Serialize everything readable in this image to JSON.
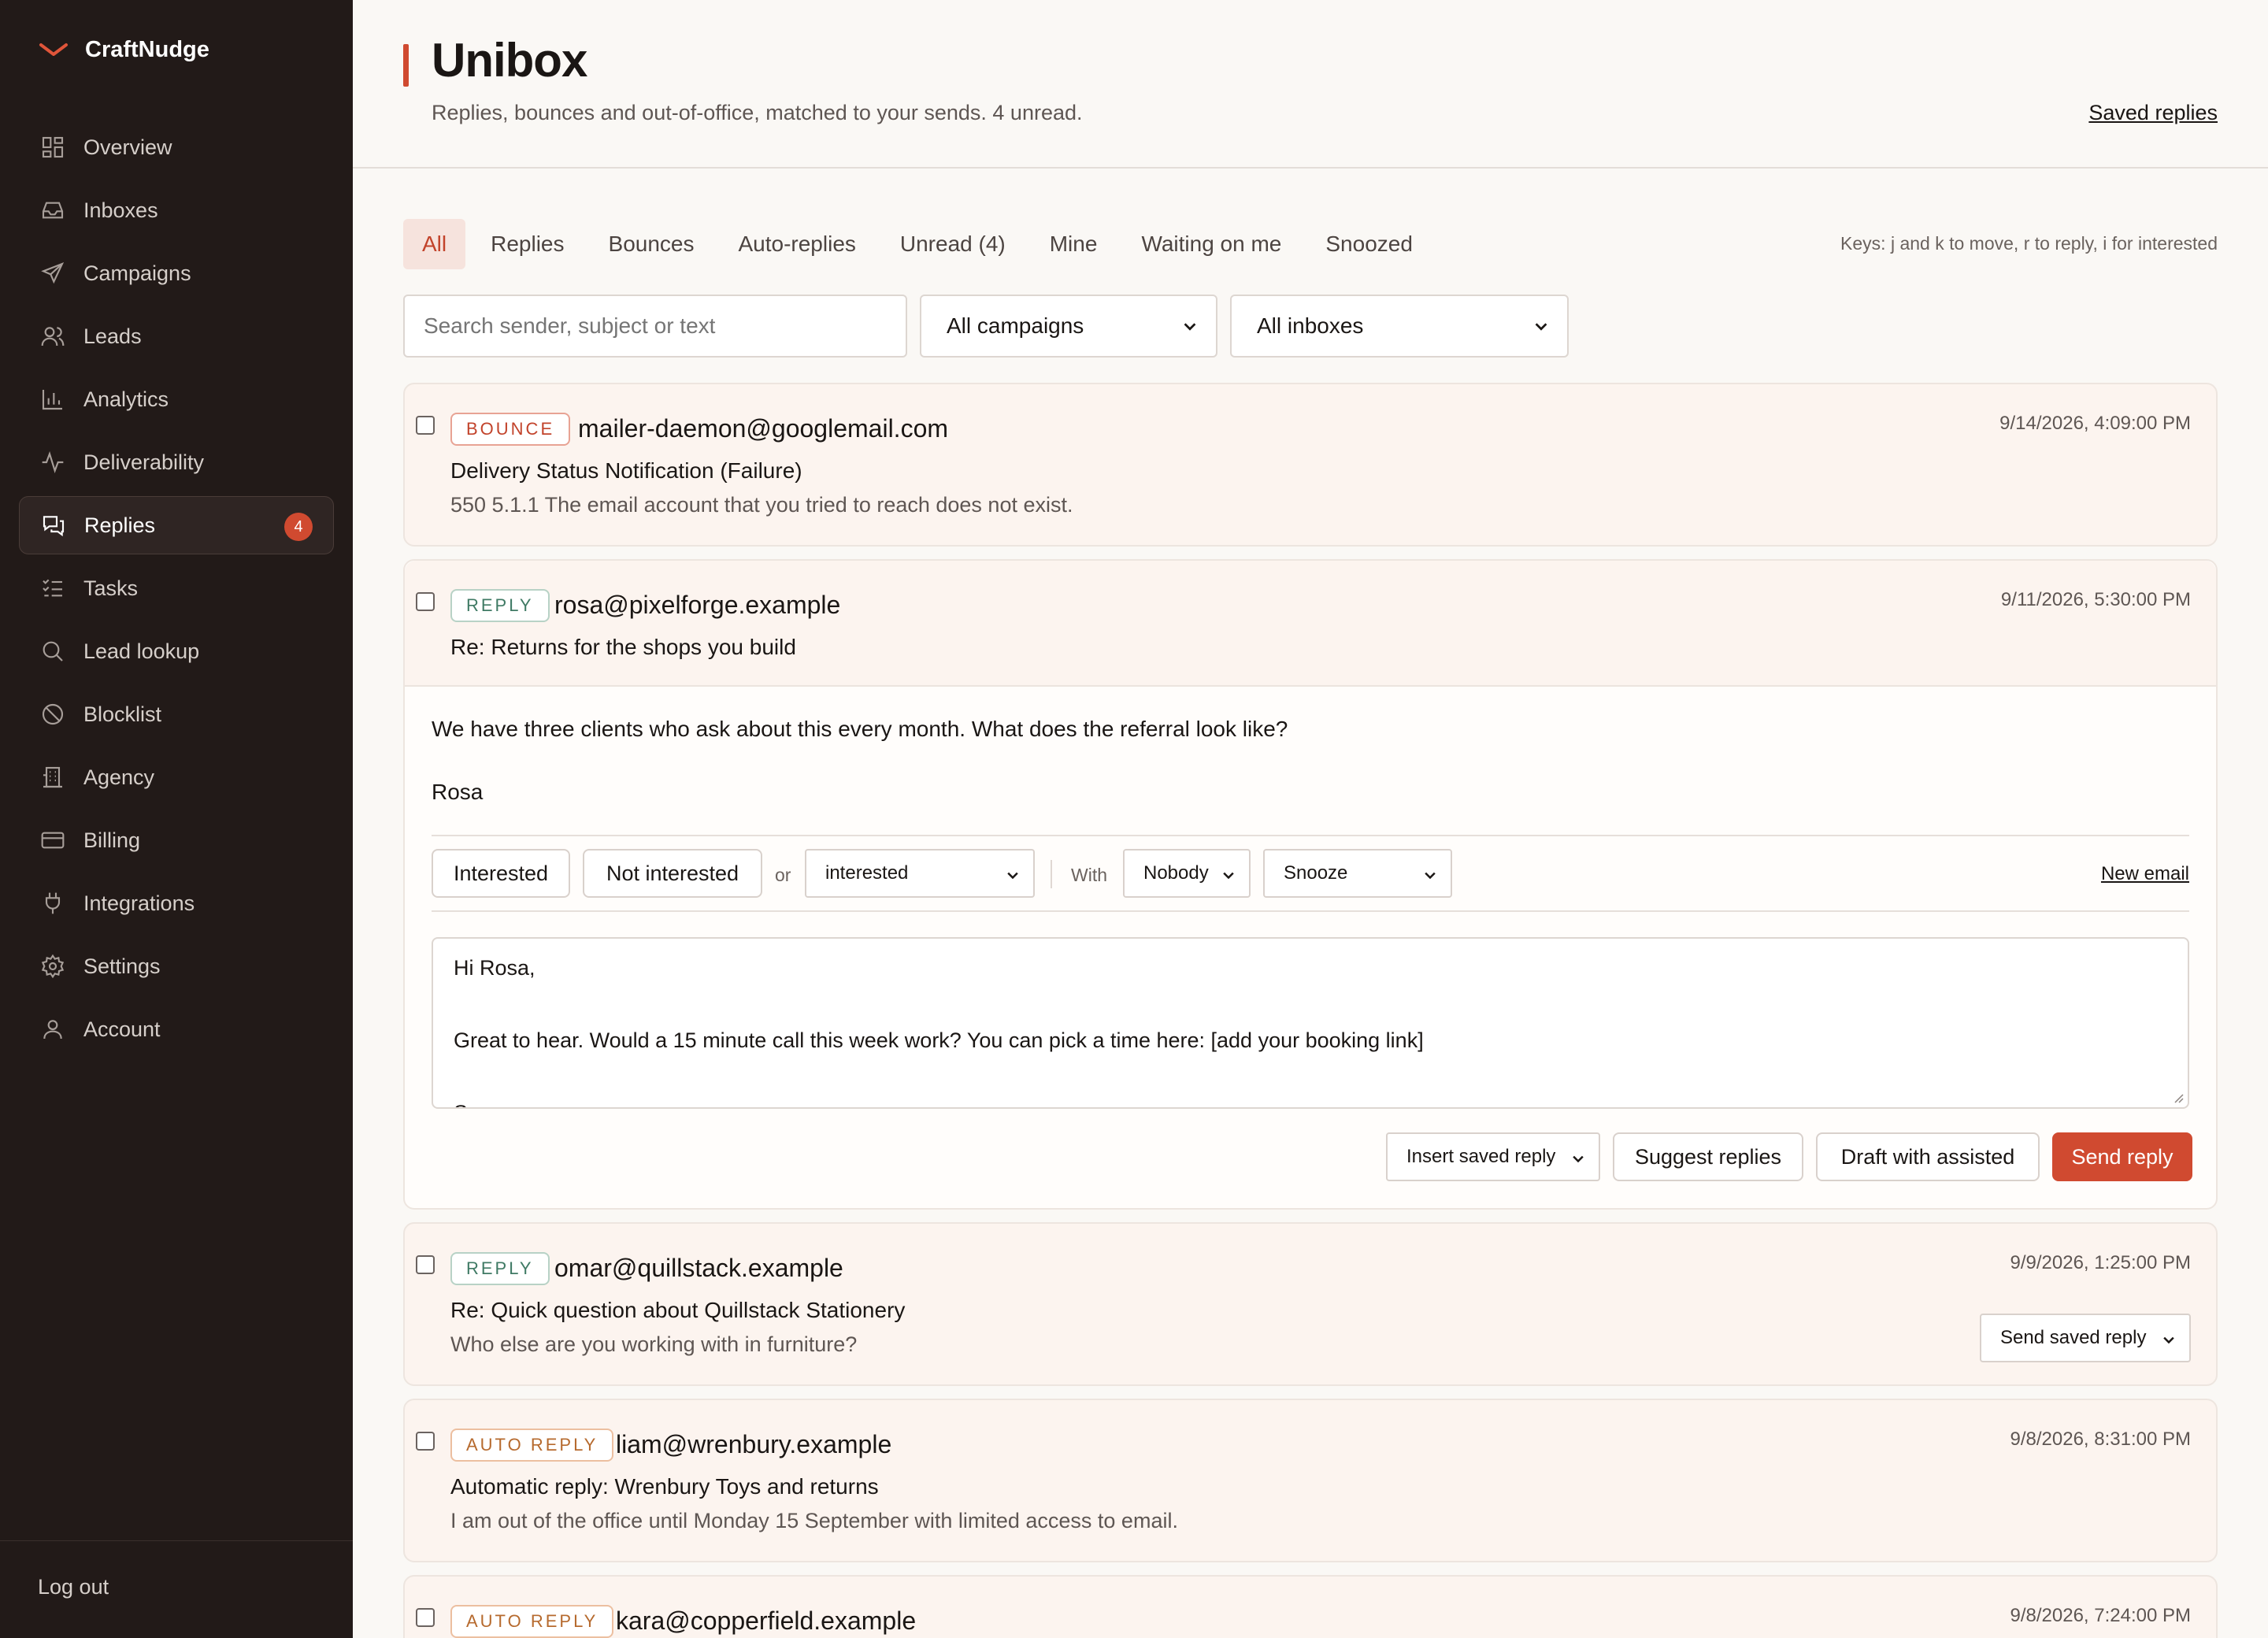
{
  "brand": {
    "name": "CraftNudge"
  },
  "nav": {
    "items": [
      {
        "label": "Overview",
        "icon": "grid-icon"
      },
      {
        "label": "Inboxes",
        "icon": "inbox-icon"
      },
      {
        "label": "Campaigns",
        "icon": "send-icon"
      },
      {
        "label": "Leads",
        "icon": "users-icon"
      },
      {
        "label": "Analytics",
        "icon": "bar-chart-icon"
      },
      {
        "label": "Deliverability",
        "icon": "pulse-icon"
      },
      {
        "label": "Replies",
        "icon": "chat-icon",
        "badge": "4",
        "active": true
      },
      {
        "label": "Tasks",
        "icon": "checklist-icon"
      },
      {
        "label": "Lead lookup",
        "icon": "search-icon"
      },
      {
        "label": "Blocklist",
        "icon": "ban-icon"
      },
      {
        "label": "Agency",
        "icon": "building-icon"
      },
      {
        "label": "Billing",
        "icon": "credit-card-icon"
      },
      {
        "label": "Integrations",
        "icon": "plug-icon"
      },
      {
        "label": "Settings",
        "icon": "gear-icon"
      },
      {
        "label": "Account",
        "icon": "user-icon"
      }
    ],
    "logout": "Log out"
  },
  "header": {
    "title": "Unibox",
    "subtitle": "Replies, bounces and out-of-office, matched to your sends. 4 unread.",
    "saved_replies": "Saved replies"
  },
  "tabs": [
    "All",
    "Replies",
    "Bounces",
    "Auto-replies",
    "Unread (4)",
    "Mine",
    "Waiting on me",
    "Snoozed"
  ],
  "keys_hint": "Keys: j and k to move, r to reply, i for interested",
  "filters": {
    "search_placeholder": "Search sender, subject or text",
    "campaign": "All campaigns",
    "inbox": "All inboxes"
  },
  "messages": [
    {
      "type": "BOUNCE",
      "sender": "mailer-daemon@googlemail.com",
      "time": "9/14/2026, 4:09:00 PM",
      "subject": "Delivery Status Notification (Failure)",
      "snippet": "550 5.1.1 The email account that you tried to reach does not exist."
    },
    {
      "type": "REPLY",
      "sender": "rosa@pixelforge.example",
      "time": "9/11/2026, 5:30:00 PM",
      "subject": "Re: Returns for the shops you build",
      "body": [
        "We have three clients who ask about this every month. What does the referral look like?",
        "Rosa"
      ]
    },
    {
      "type": "REPLY",
      "sender": "omar@quillstack.example",
      "time": "9/9/2026, 1:25:00 PM",
      "subject": "Re: Quick question about Quillstack Stationery",
      "snippet": "Who else are you working with in furniture?",
      "action": "Send saved reply"
    },
    {
      "type": "AUTO REPLY",
      "sender": "liam@wrenbury.example",
      "time": "9/8/2026, 8:31:00 PM",
      "subject": "Automatic reply: Wrenbury Toys and returns",
      "snippet": "I am out of the office until Monday 15 September with limited access to email."
    },
    {
      "type": "AUTO REPLY",
      "sender": "kara@copperfield.example",
      "time": "9/8/2026, 7:24:00 PM"
    }
  ],
  "triage": {
    "interested": "Interested",
    "not_interested": "Not interested",
    "or": "or",
    "status": "interested",
    "with": "With",
    "assignee": "Nobody",
    "snooze": "Snooze",
    "new_email": "New email"
  },
  "draft": {
    "line1": "Hi Rosa,",
    "line2": "Great to hear. Would a 15 minute call this week work? You can pick a time here: [add your booking link]",
    "line3": "S"
  },
  "composer": {
    "insert_saved": "Insert saved reply",
    "suggest": "Suggest replies",
    "draft_assisted": "Draft with assisted",
    "send": "Send reply"
  },
  "colors": {
    "sidebar": "#221a18",
    "accent": "#d04a30",
    "page": "#faf8f5"
  }
}
